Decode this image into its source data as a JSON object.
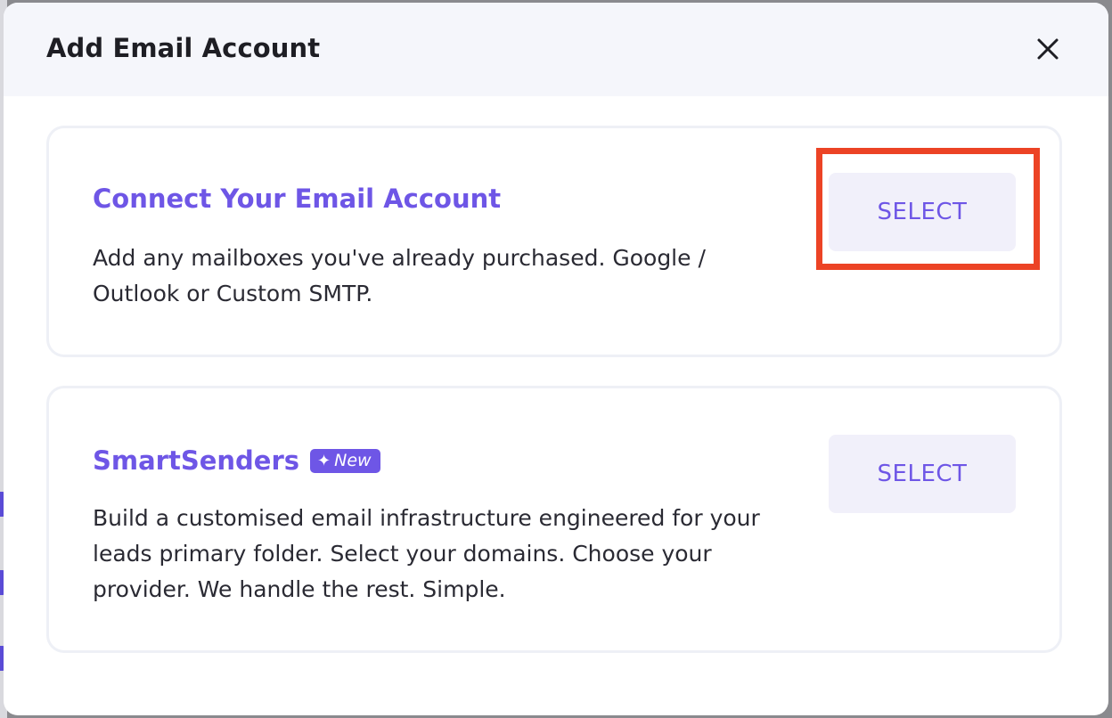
{
  "modal": {
    "title": "Add Email Account",
    "close_icon": "close-icon"
  },
  "options": [
    {
      "title": "Connect Your Email Account",
      "description": "Add any mailboxes you've already purchased. Google / Outlook or Custom SMTP.",
      "button_label": "SELECT",
      "highlighted": true
    },
    {
      "title": "SmartSenders",
      "badge": {
        "icon": "sparkle-icon",
        "label": "New"
      },
      "description": "Build a customised email infrastructure engineered for your leads primary folder. Select your domains. Choose your provider. We handle the rest. Simple.",
      "button_label": "SELECT",
      "highlighted": false
    }
  ],
  "colors": {
    "accent": "#6e56e6",
    "button_bg": "#f1f0fa",
    "header_bg": "#f5f6fb",
    "highlight": "#ec4325"
  }
}
